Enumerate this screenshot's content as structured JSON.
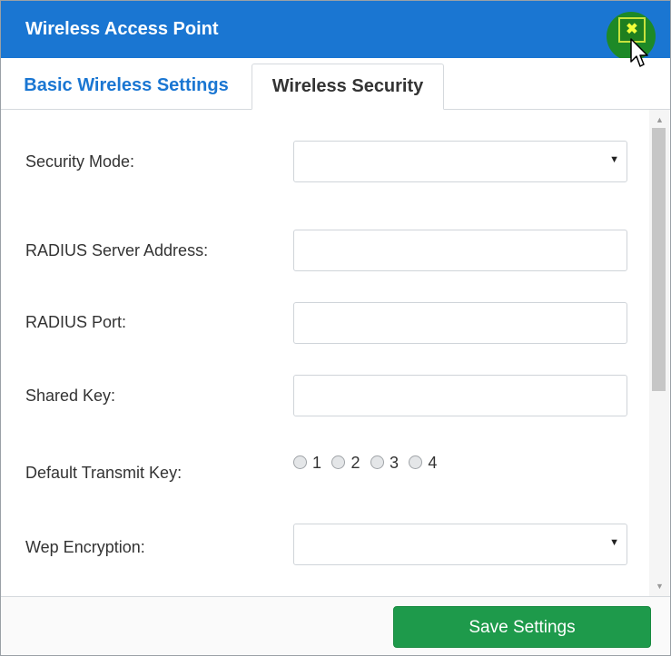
{
  "window": {
    "title": "Wireless Access Point"
  },
  "tabs": [
    {
      "label": "Basic Wireless Settings",
      "active": false
    },
    {
      "label": "Wireless Security",
      "active": true
    }
  ],
  "form": {
    "security_mode": {
      "label": "Security Mode:",
      "value": ""
    },
    "radius_server_address": {
      "label": "RADIUS Server Address:",
      "value": ""
    },
    "radius_port": {
      "label": "RADIUS Port:",
      "value": ""
    },
    "shared_key": {
      "label": "Shared Key:",
      "value": ""
    },
    "default_transmit_key": {
      "label": "Default Transmit Key:",
      "options": [
        "1",
        "2",
        "3",
        "4"
      ]
    },
    "wep_encryption": {
      "label": "Wep Encryption:",
      "value": ""
    }
  },
  "footer": {
    "save_label": "Save Settings"
  },
  "icons": {
    "close": "close-icon",
    "dropdown": "chevron-down-icon",
    "cursor": "mouse-pointer-icon"
  },
  "colors": {
    "titlebar": "#1a76d2",
    "active_tab_text": "#1a76d2",
    "save_button": "#1e9a4b",
    "close_highlight": "#1e8a1e"
  }
}
